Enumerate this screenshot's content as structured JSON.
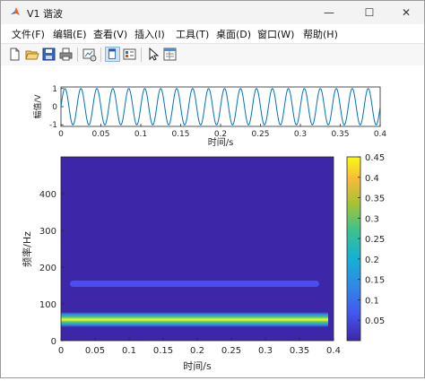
{
  "window": {
    "title": "V1 谐波",
    "minimize_glyph": "—",
    "maximize_glyph": "☐",
    "close_glyph": "✕",
    "icon": "matlab-logo-icon"
  },
  "menu": [
    "文件(F)",
    "编辑(E)",
    "查看(V)",
    "插入(I)",
    "工具(T)",
    "桌面(D)",
    "窗口(W)",
    "帮助(H)"
  ],
  "toolbar": {
    "icons": [
      "new-figure-icon",
      "open-file-icon",
      "save-icon",
      "print-icon",
      "link-plot-icon",
      "dock-figure-icon",
      "insert-colorbar-icon",
      "pointer-edit-icon",
      "property-inspector-icon"
    ],
    "selected_icon": "dock-figure-icon"
  },
  "colors": {
    "axes_line": "#262626",
    "signal": "#0072bd",
    "background_map": "#3e26a8"
  },
  "chart_data": [
    {
      "type": "line",
      "xlabel": "时间/s",
      "ylabel": "幅值/V",
      "xlim": [
        0,
        0.4
      ],
      "ylim": [
        -1,
        1
      ],
      "xticks": [
        "0",
        "0.05",
        "0.1",
        "0.15",
        "0.2",
        "0.25",
        "0.3",
        "0.35",
        "0.4"
      ],
      "yticks": [
        "1",
        "0",
        "-1"
      ],
      "series": [
        {
          "function": "sin(2π·50·t)",
          "frequency_hz": 50,
          "amplitude": 1
        }
      ]
    },
    {
      "type": "heatmap",
      "xlabel": "时间/s",
      "ylabel": "频率/Hz",
      "xlim": [
        0,
        0.4
      ],
      "ylim": [
        0,
        500
      ],
      "xticks": [
        "0",
        "0.05",
        "0.1",
        "0.15",
        "0.2",
        "0.25",
        "0.3",
        "0.35",
        "0.4"
      ],
      "yticks": [
        "400",
        "300",
        "200",
        "100",
        "0"
      ],
      "colormap": "parula",
      "colorbar": {
        "range": [
          0,
          0.45
        ],
        "ticks": [
          "0.45",
          "0.4",
          "0.35",
          "0.3",
          "0.25",
          "0.2",
          "0.15",
          "0.1",
          "0.05"
        ]
      },
      "features": [
        {
          "name": "band-50hz",
          "frequency_hz": 50,
          "time_range": [
            0,
            0.4
          ],
          "magnitude": 0.45
        },
        {
          "name": "band-150hz",
          "frequency_hz": 150,
          "time_range": [
            0.02,
            0.38
          ],
          "magnitude": 0.1
        }
      ]
    }
  ]
}
